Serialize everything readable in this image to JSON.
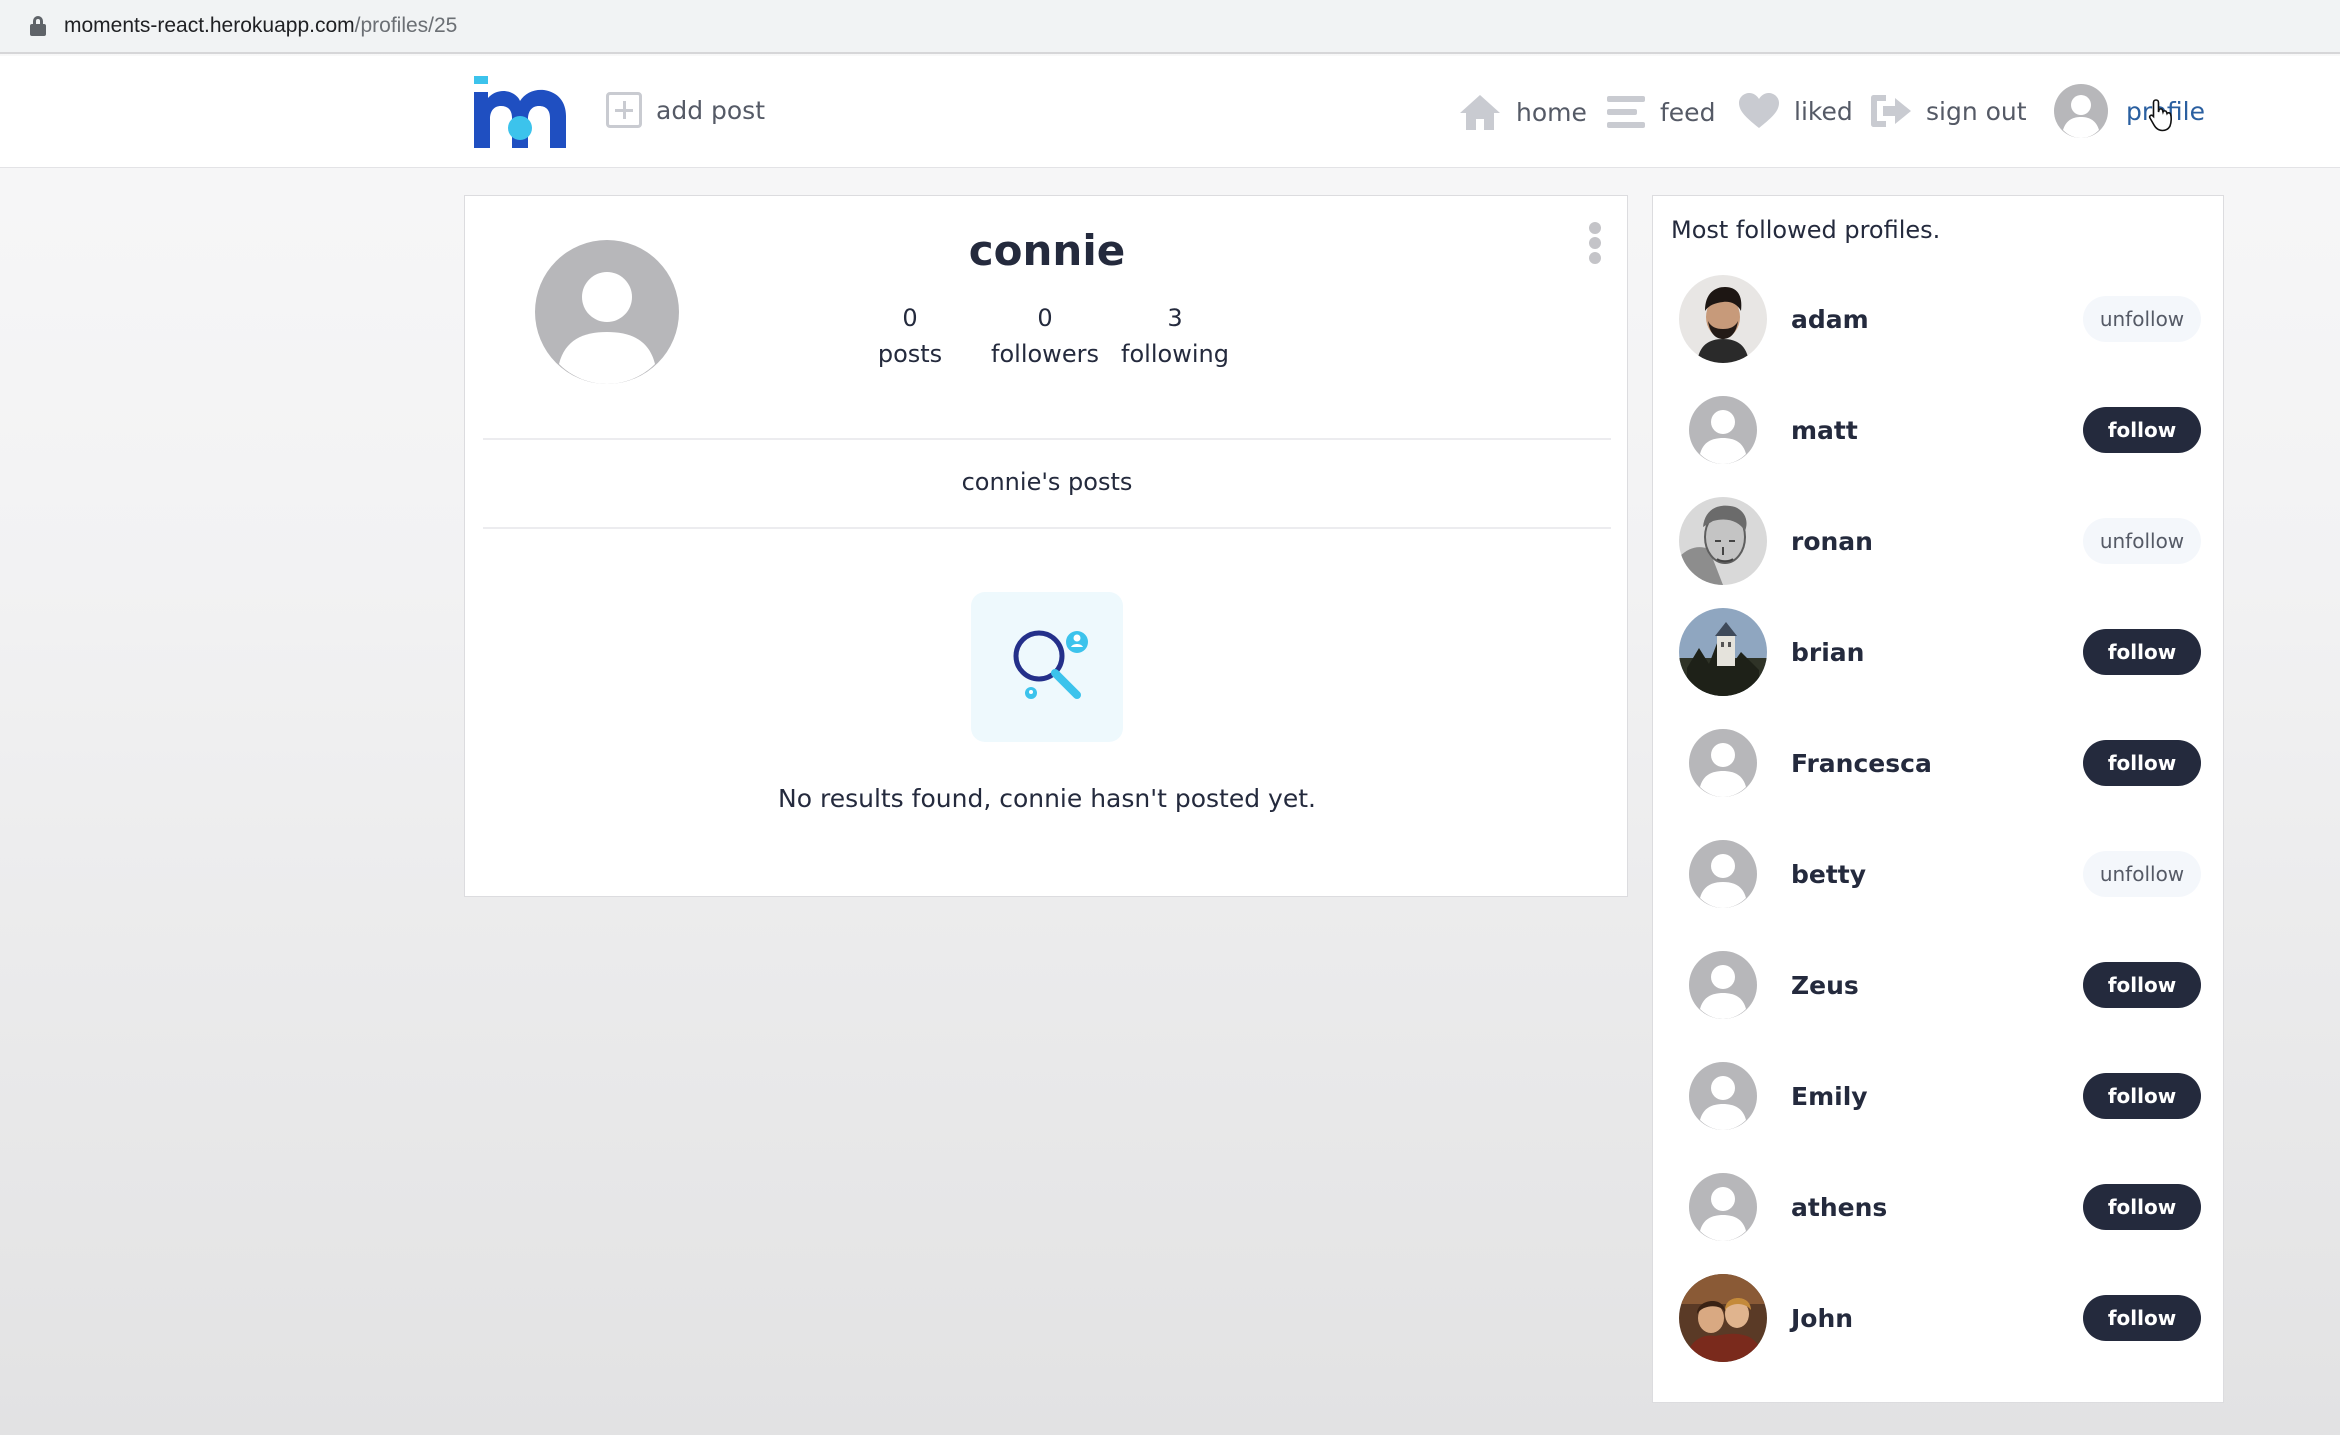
{
  "browser": {
    "url_host": "moments-react.herokuapp.com",
    "url_path": "/profiles/25"
  },
  "navbar": {
    "add_post": "add post",
    "home": "home",
    "feed": "feed",
    "liked": "liked",
    "sign_out": "sign out",
    "profile": "profile"
  },
  "profile": {
    "username": "connie",
    "posts_count": "0",
    "posts_label": "posts",
    "followers_count": "0",
    "followers_label": "followers",
    "following_count": "3",
    "following_label": "following",
    "posts_title": "connie's posts",
    "no_results": "No results found, connie hasn't posted yet."
  },
  "sidebar": {
    "title": "Most followed profiles.",
    "profiles": [
      {
        "name": "adam",
        "action": "unfollow"
      },
      {
        "name": "matt",
        "action": "follow"
      },
      {
        "name": "ronan",
        "action": "unfollow"
      },
      {
        "name": "brian",
        "action": "follow"
      },
      {
        "name": "Francesca",
        "action": "follow"
      },
      {
        "name": "betty",
        "action": "unfollow"
      },
      {
        "name": "Zeus",
        "action": "follow"
      },
      {
        "name": "Emily",
        "action": "follow"
      },
      {
        "name": "athens",
        "action": "follow"
      },
      {
        "name": "John",
        "action": "follow"
      }
    ]
  },
  "colors": {
    "brand_blue": "#1f4fc1",
    "brand_cyan": "#3cc3ec",
    "dark_button": "#242a3d",
    "nav_text": "#555a66"
  }
}
